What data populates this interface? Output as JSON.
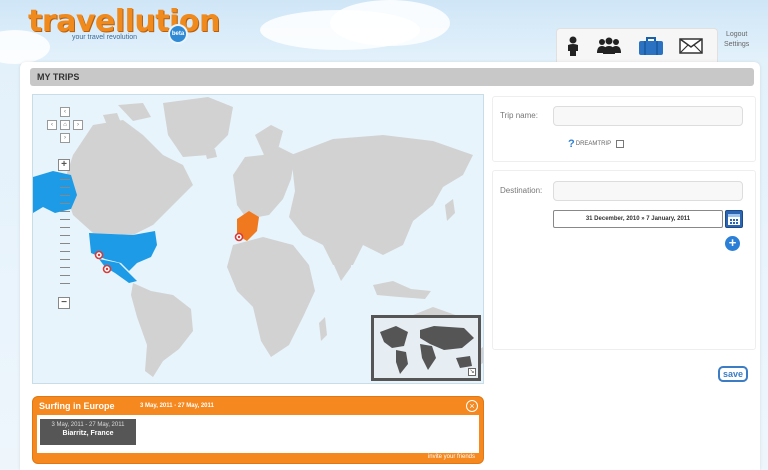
{
  "header": {
    "logo_main": "travellution",
    "tagline": "your travel revolution",
    "beta": "beta",
    "nav_tabs": [
      {
        "icon": "person-icon"
      },
      {
        "icon": "group-icon"
      },
      {
        "icon": "suitcase-icon"
      },
      {
        "icon": "envelope-icon"
      }
    ],
    "logout": "Logout",
    "settings": "Settings"
  },
  "page": {
    "section_title": "MY TRIPS"
  },
  "form": {
    "trip_name_label": "Trip name:",
    "trip_name_value": "",
    "dreamtrip_label": "DREAMTRIP",
    "dreamtrip_checked": false,
    "destination_label": "Destination:",
    "destination_value": "",
    "date_range": "31 December, 2010 » 7 January, 2011",
    "save": "save"
  },
  "trip_card": {
    "title": "Surfing in Europe",
    "dates": "3 May, 2011 - 27 May, 2011",
    "stops": [
      {
        "dates": "3 May, 2011 - 27 May, 2011",
        "place": "Biarritz, France"
      }
    ],
    "invite": "invite your friends"
  },
  "colors": {
    "accent_orange": "#f5881f",
    "highlight_blue": "#1e9be6",
    "highlight_orange": "#f0781e",
    "land_gray": "#d2d2d2",
    "ocean": "#e8f4fb"
  }
}
